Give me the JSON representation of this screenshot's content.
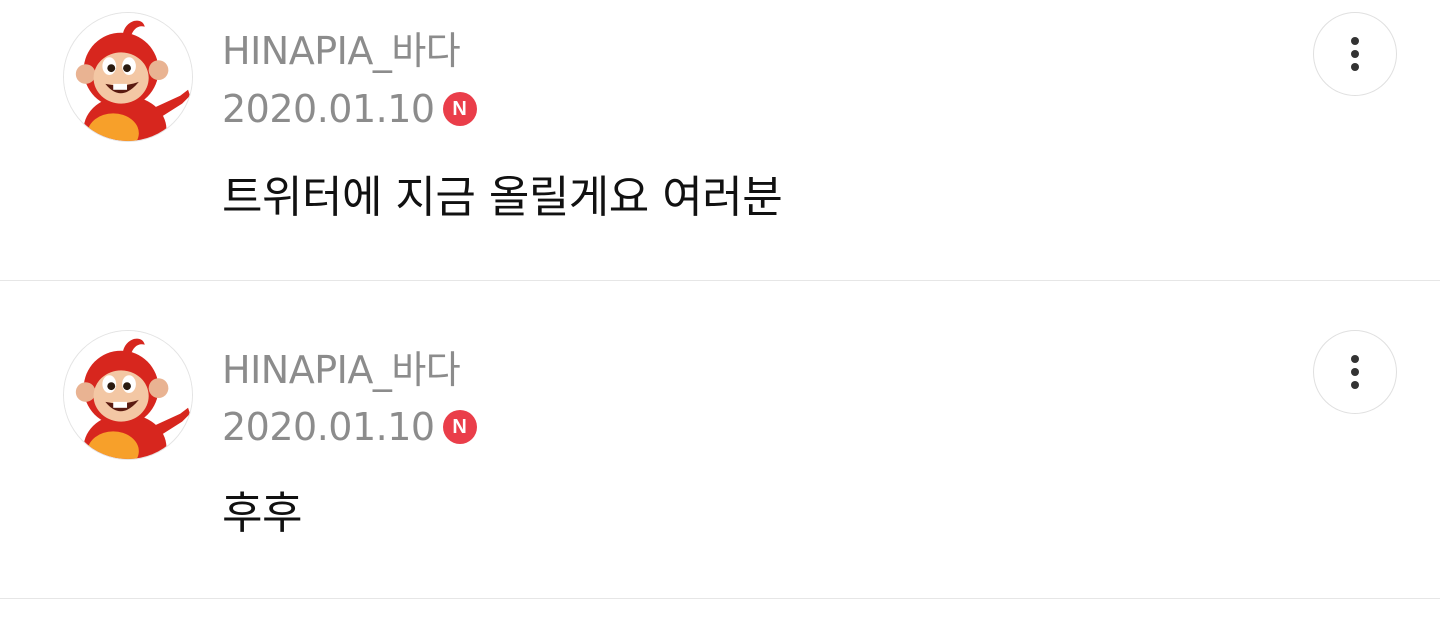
{
  "comments": [
    {
      "author": "HINAPIA_바다",
      "date": "2020.01.10",
      "badge": "N",
      "text": "트위터에 지금 올릴게요 여러분",
      "avatar_icon": "monkey-mascot-icon",
      "more_icon": "more-vertical-icon"
    },
    {
      "author": "HINAPIA_바다",
      "date": "2020.01.10",
      "badge": "N",
      "text": "후후",
      "avatar_icon": "monkey-mascot-icon",
      "more_icon": "more-vertical-icon"
    }
  ],
  "colors": {
    "badge": "#ea3e4a",
    "meta_text": "#8c8c8c",
    "body_text": "#111111",
    "divider": "#e6e6e6"
  }
}
